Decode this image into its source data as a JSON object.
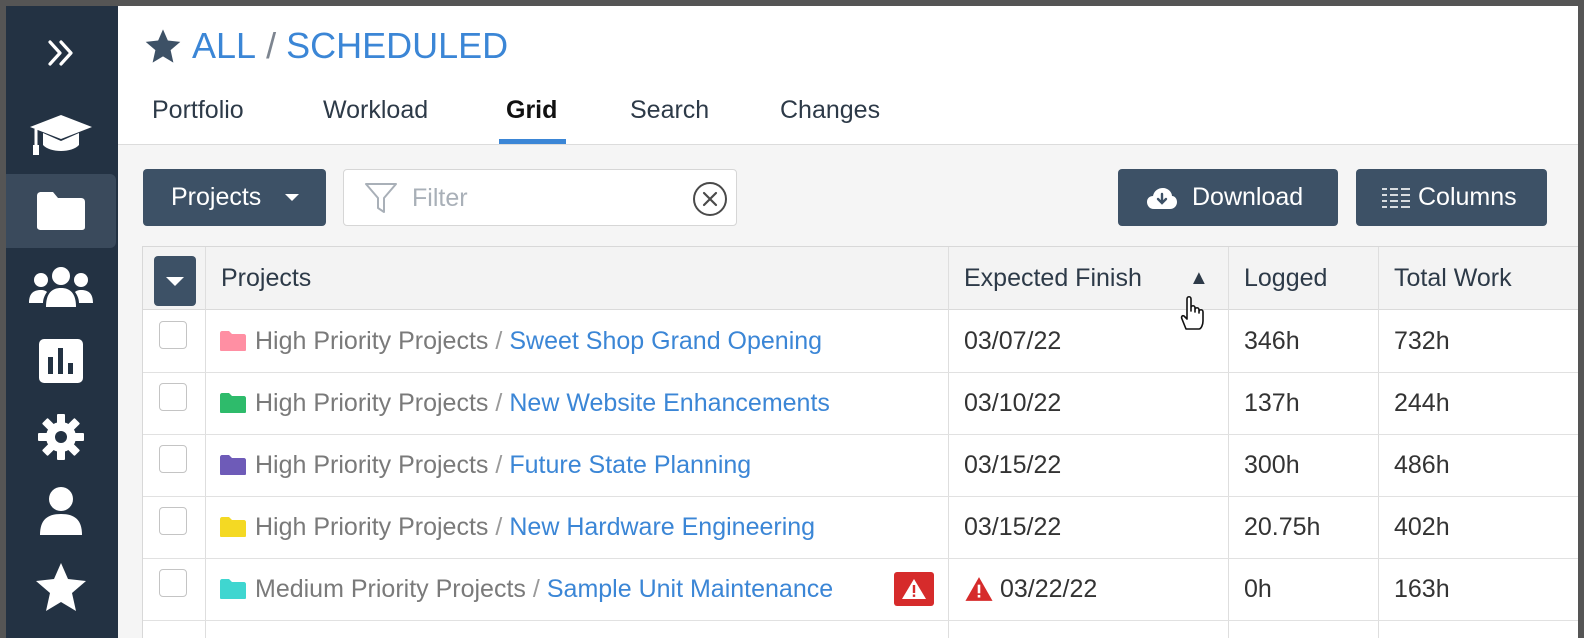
{
  "sidebar": {
    "items": [
      {
        "icon": "double-chevron-right-icon"
      },
      {
        "icon": "graduation-cap-icon"
      },
      {
        "icon": "folder-icon",
        "active": true
      },
      {
        "icon": "users-icon"
      },
      {
        "icon": "bar-chart-icon"
      },
      {
        "icon": "gear-icon"
      },
      {
        "icon": "user-icon"
      },
      {
        "icon": "star-icon"
      }
    ]
  },
  "header": {
    "breadcrumb": {
      "root": "ALL",
      "separator": "/",
      "current": "SCHEDULED"
    },
    "tabs": [
      {
        "label": "Portfolio"
      },
      {
        "label": "Workload"
      },
      {
        "label": "Grid",
        "active": true
      },
      {
        "label": "Search"
      },
      {
        "label": "Changes"
      }
    ]
  },
  "toolbar": {
    "projects_label": "Projects",
    "filter_placeholder": "Filter",
    "download_label": "Download",
    "columns_label": "Columns"
  },
  "grid": {
    "columns": {
      "projects": "Projects",
      "expected_finish": "Expected Finish",
      "logged": "Logged",
      "total_work": "Total Work"
    },
    "sort": {
      "column": "Expected Finish",
      "direction": "ascending"
    },
    "rows": [
      {
        "group": "High Priority Projects",
        "name": "Sweet Shop Grand Opening",
        "folder_color": "#ff8fa3",
        "finish": "03/07/22",
        "logged": "346h",
        "total": "732h",
        "warning": false
      },
      {
        "group": "High Priority Projects",
        "name": "New Website Enhancements",
        "folder_color": "#2ebb6b",
        "finish": "03/10/22",
        "logged": "137h",
        "total": "244h",
        "warning": false
      },
      {
        "group": "High Priority Projects",
        "name": "Future State Planning",
        "folder_color": "#6e5bb8",
        "finish": "03/15/22",
        "logged": "300h",
        "total": "486h",
        "warning": false
      },
      {
        "group": "High Priority Projects",
        "name": "New Hardware Engineering",
        "folder_color": "#f4d923",
        "finish": "03/15/22",
        "logged": "20.75h",
        "total": "402h",
        "warning": false
      },
      {
        "group": "Medium Priority Projects",
        "name": "Sample Unit Maintenance",
        "folder_color": "#3fd6d0",
        "finish": "03/22/22",
        "logged": "0h",
        "total": "163h",
        "warning": true
      }
    ]
  },
  "colors": {
    "sidebar_bg": "#233243",
    "accent_blue": "#3b86d6",
    "button_dark": "#3d5166",
    "warning_red": "#d62b2b"
  }
}
